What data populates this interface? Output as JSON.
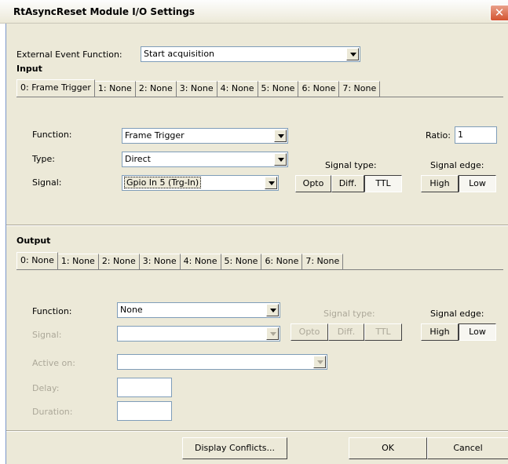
{
  "window": {
    "title": "RtAsyncReset Module I/O Settings",
    "close_symbol": "✕"
  },
  "external_event": {
    "label": "External Event Function:",
    "value": "Start acquisition"
  },
  "input": {
    "title": "Input",
    "tabs": [
      "0: Frame Trigger",
      "1: None",
      "2: None",
      "3: None",
      "4: None",
      "5: None",
      "6: None",
      "7: None"
    ],
    "function_label": "Function:",
    "function_value": "Frame Trigger",
    "type_label": "Type:",
    "type_value": "Direct",
    "signal_label": "Signal:",
    "signal_value": "Gpio In 5 (Trg-In)",
    "ratio_label": "Ratio:",
    "ratio_value": "1",
    "signal_type_label": "Signal type:",
    "signal_type_options": [
      "Opto",
      "Diff.",
      "TTL"
    ],
    "signal_type_selected": "TTL",
    "signal_edge_label": "Signal edge:",
    "signal_edge_options": [
      "High",
      "Low"
    ],
    "signal_edge_selected": "Low"
  },
  "output": {
    "title": "Output",
    "tabs": [
      "0: None",
      "1: None",
      "2: None",
      "3: None",
      "4: None",
      "5: None",
      "6: None",
      "7: None"
    ],
    "function_label": "Function:",
    "function_value": "None",
    "signal_label": "Signal:",
    "signal_value": "",
    "active_on_label": "Active on:",
    "active_on_value": "",
    "delay_label": "Delay:",
    "delay_value": "",
    "duration_label": "Duration:",
    "duration_value": "",
    "signal_type_label": "Signal type:",
    "signal_type_options": [
      "Opto",
      "Diff.",
      "TTL"
    ],
    "signal_edge_label": "Signal edge:",
    "signal_edge_options": [
      "High",
      "Low"
    ],
    "signal_edge_selected": "Low"
  },
  "buttons": {
    "display_conflicts": "Display Conflicts...",
    "ok": "OK",
    "cancel": "Cancel"
  }
}
